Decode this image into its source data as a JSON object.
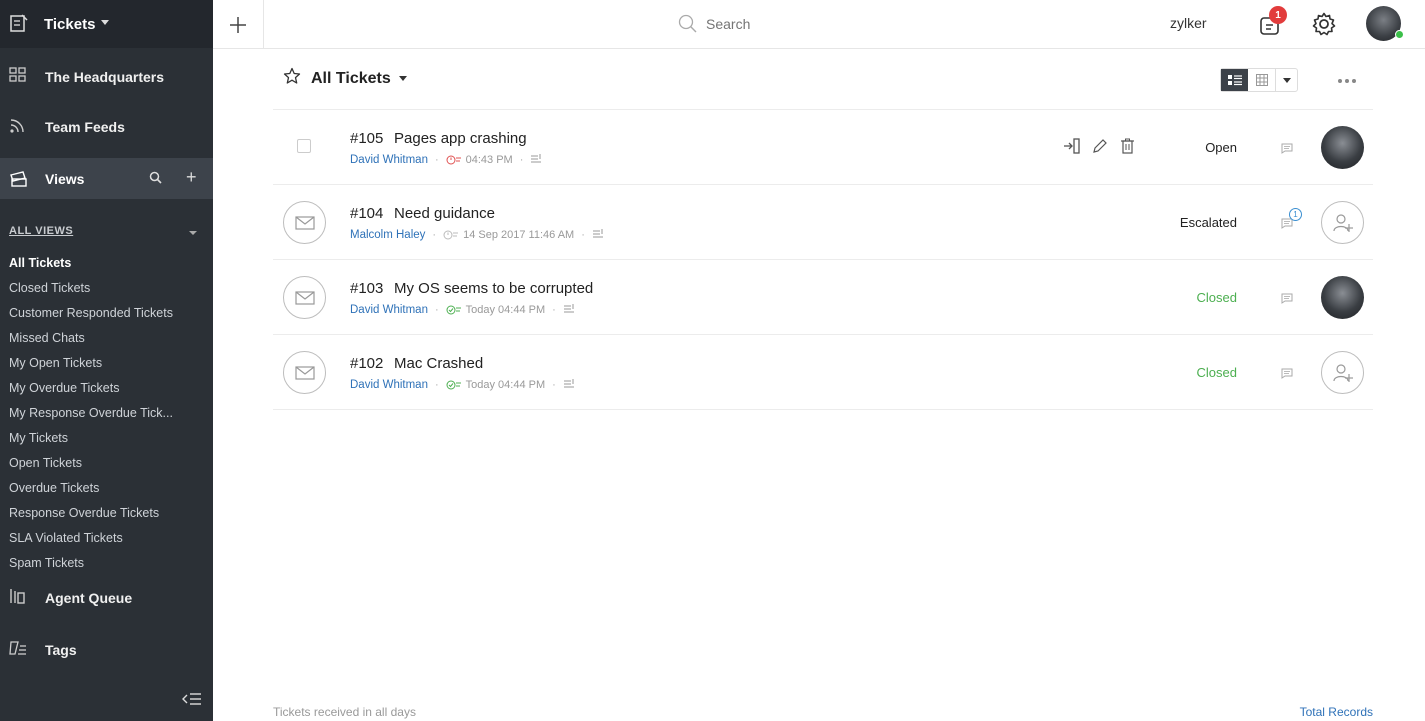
{
  "sidebar": {
    "module": "Tickets",
    "items": [
      {
        "label": "The Headquarters",
        "icon": "grid-icon"
      },
      {
        "label": "Team Feeds",
        "icon": "feed-icon"
      }
    ],
    "views_label": "Views",
    "all_views_label": "ALL VIEWS",
    "views": [
      "All Tickets",
      "Closed Tickets",
      "Customer Responded Tickets",
      "Missed Chats",
      "My Open Tickets",
      "My Overdue Tickets",
      "My Response Overdue Tick...",
      "My Tickets",
      "Open Tickets",
      "Overdue Tickets",
      "Response Overdue Tickets",
      "SLA Violated Tickets",
      "Spam Tickets"
    ],
    "agent_queue_label": "Agent Queue",
    "tags_label": "Tags"
  },
  "topbar": {
    "search_placeholder": "Search",
    "org_name": "zylker",
    "notification_count": "1"
  },
  "main": {
    "view_title": "All Tickets",
    "tickets": [
      {
        "number": "#105",
        "subject": "Pages app crashing",
        "contact": "David Whitman",
        "time": "04:43 PM",
        "status": "Open",
        "status_type": "open",
        "owner": "avatar",
        "comment_count": ""
      },
      {
        "number": "#104",
        "subject": "Need guidance",
        "contact": "Malcolm Haley",
        "time": "14 Sep 2017 11:46 AM",
        "status": "Escalated",
        "status_type": "open",
        "owner": "empty",
        "comment_count": "1"
      },
      {
        "number": "#103",
        "subject": "My OS seems to be corrupted",
        "contact": "David Whitman",
        "time": "Today 04:44 PM",
        "status": "Closed",
        "status_type": "closed",
        "owner": "avatar",
        "comment_count": ""
      },
      {
        "number": "#102",
        "subject": "Mac Crashed",
        "contact": "David Whitman",
        "time": "Today 04:44 PM",
        "status": "Closed",
        "status_type": "closed",
        "owner": "empty",
        "comment_count": ""
      }
    ],
    "footer_left": "Tickets received in all days",
    "footer_right": "Total Records"
  },
  "colors": {
    "sidebar_bg": "#2b3036",
    "link_blue": "#2f72b8",
    "closed_green": "#4caf50",
    "badge_red": "#e23c3c"
  }
}
